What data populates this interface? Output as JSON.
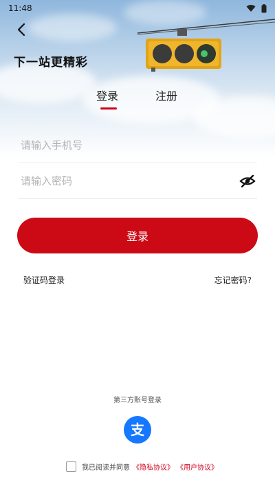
{
  "status_bar": {
    "time": "11:48",
    "icons": [
      "wifi-icon",
      "battery-icon"
    ]
  },
  "header": {
    "back_icon": "chevron-left-icon",
    "headline": "下一站更精彩"
  },
  "tabs": [
    {
      "label": "登录",
      "active": true
    },
    {
      "label": "注册",
      "active": false
    }
  ],
  "form": {
    "phone_placeholder": "请输入手机号",
    "phone_value": "",
    "password_placeholder": "请输入密码",
    "password_value": "",
    "visibility_icon": "eye-off-icon"
  },
  "actions": {
    "login_label": "登录",
    "sms_login_label": "验证码登录",
    "forgot_label": "忘记密码?"
  },
  "third_party": {
    "label": "第三方账号登录",
    "providers": [
      {
        "icon": "alipay-icon",
        "glyph": "支"
      }
    ]
  },
  "agreement": {
    "checked": false,
    "prefix": "我已阅读并同意",
    "privacy_link": "《隐私协议》",
    "user_link": "《用户协议》"
  },
  "colors": {
    "accent": "#cc0a16",
    "alipay": "#1677ff"
  }
}
